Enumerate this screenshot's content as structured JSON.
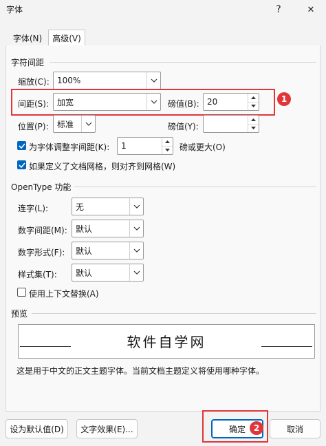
{
  "window": {
    "title": "字体",
    "help_glyph": "?",
    "close_glyph": "✕"
  },
  "tabs": [
    {
      "label": "字体(N)"
    },
    {
      "label": "高级(V)"
    }
  ],
  "char_spacing": {
    "section_title": "字符间距",
    "scale_label": "缩放(C):",
    "scale_value": "100%",
    "spacing_label": "间距(S):",
    "spacing_value": "加宽",
    "spacing_by_label": "磅值(B):",
    "spacing_by_value": "20",
    "position_label": "位置(P):",
    "position_value": "标准",
    "position_by_label": "磅值(Y):",
    "position_by_value": "",
    "kerning_label": "为字体调整字间距(K):",
    "kerning_checked": true,
    "kerning_value": "1",
    "kerning_suffix": "磅或更大(O)",
    "snap_grid_label": "如果定义了文档网格，则对齐到网格(W)",
    "snap_grid_checked": true
  },
  "opentype": {
    "section_title": "OpenType 功能",
    "ligatures_label": "连字(L):",
    "ligatures_value": "无",
    "num_spacing_label": "数字间距(M):",
    "num_spacing_value": "默认",
    "num_forms_label": "数字形式(F):",
    "num_forms_value": "默认",
    "stylistic_label": "样式集(T):",
    "stylistic_value": "默认",
    "contextual_label": "使用上下文替换(A)",
    "contextual_checked": false
  },
  "preview": {
    "section_title": "预览",
    "sample_text": "软件自学网",
    "description": "这是用于中文的正文主题字体。当前文档主题定义将使用哪种字体。"
  },
  "annotations": {
    "badge1": "1",
    "badge2": "2",
    "color": "#e0363a"
  },
  "buttons": {
    "set_default": "设为默认值(D)",
    "text_effects": "文字效果(E)...",
    "ok": "确定",
    "cancel": "取消"
  },
  "colors": {
    "accent": "#0067c0",
    "annotation": "#e0363a"
  }
}
